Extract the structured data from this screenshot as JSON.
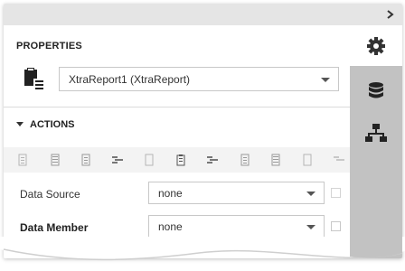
{
  "panel": {
    "properties_title": "PROPERTIES",
    "report_selector": {
      "value": "XtraReport1 (XtraReport)"
    },
    "actions_title": "ACTIONS",
    "toolbar_icons": [
      "align-left-icon",
      "align-center-icon",
      "align-right-icon",
      "align-justify-icon",
      "size-icon",
      "clipboard-icon",
      "align-justify-icon",
      "distribute-icon",
      "align-bottom-icon",
      "align-middle-icon",
      "align-justify-icon"
    ],
    "properties": [
      {
        "label": "Data Source",
        "value": "none",
        "bold": false
      },
      {
        "label": "Data Member",
        "value": "none",
        "bold": true
      }
    ]
  },
  "side_tabs": [
    "gear-icon",
    "database-icon",
    "hierarchy-icon"
  ],
  "colors": {
    "topbar": "#e5e5e5",
    "side_column": "#c2c2c2",
    "toolbar_strip": "#f3f3f3",
    "icon_dark": "#333333",
    "icon_disabled": "#b5b5b5"
  }
}
